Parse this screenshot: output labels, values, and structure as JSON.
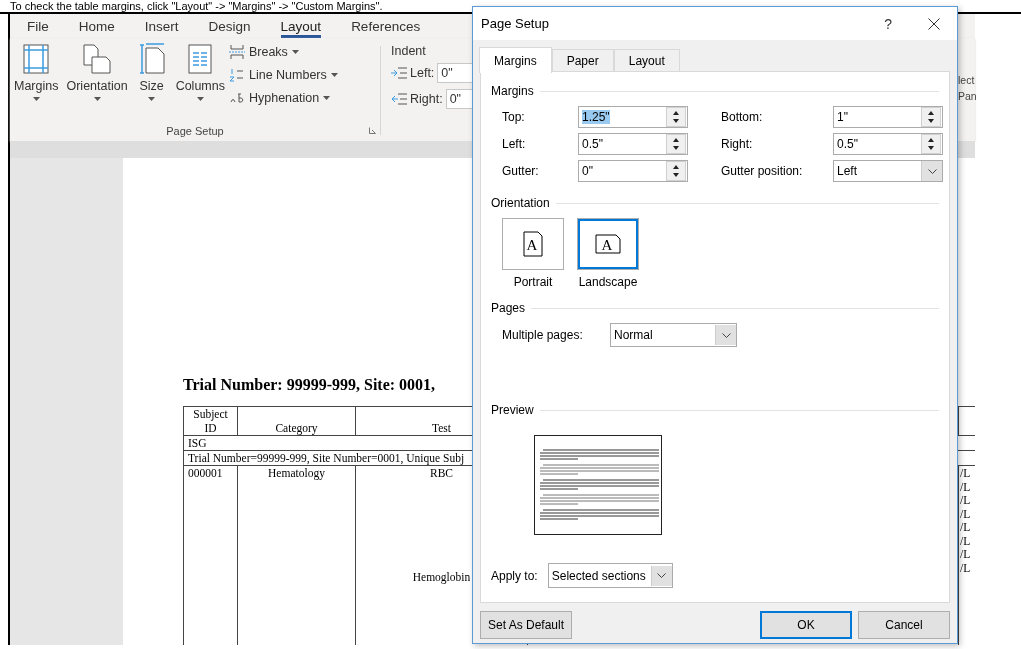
{
  "caption": "To check the table margins, click \"Layout\" -> \"Margins\" -> \"Custom Margins\".",
  "word": {
    "tabs": [
      {
        "label": "File",
        "selected": false
      },
      {
        "label": "Home",
        "selected": false
      },
      {
        "label": "Insert",
        "selected": false
      },
      {
        "label": "Design",
        "selected": false
      },
      {
        "label": "Layout",
        "selected": true
      },
      {
        "label": "References",
        "selected": false
      }
    ],
    "ribbon": {
      "big_buttons": [
        "Margins",
        "Orientation",
        "Size",
        "Columns"
      ],
      "small_buttons": [
        "Breaks",
        "Line Numbers",
        "Hyphenation"
      ],
      "group_label": "Page Setup",
      "indent": {
        "title": "Indent",
        "fields": [
          {
            "label": "Left:",
            "value": "0\""
          },
          {
            "label": "Right:",
            "value": "0\""
          }
        ]
      },
      "right_fragments": [
        "lect",
        "Pan"
      ]
    }
  },
  "document": {
    "title": "Trial Number: 99999-999, Site: 0001,",
    "table": {
      "columns": [
        "Subject ID",
        "Category",
        "Test"
      ],
      "group_row": "ISG",
      "info_row": "Trial Number=99999-999, Site Number=0001, Unique Subj",
      "rows": [
        {
          "subject_id": "000001",
          "category": "Hematology",
          "tests": [
            "RBC",
            "Hemoglobin"
          ]
        }
      ],
      "unit_fragments": [
        "/L",
        "/L",
        "/L",
        "/L",
        "/L",
        "/L",
        "/L",
        "/L"
      ]
    }
  },
  "dialog": {
    "title": "Page Setup",
    "help": "?",
    "tabs": [
      {
        "label": "Margins",
        "selected": true
      },
      {
        "label": "Paper",
        "selected": false
      },
      {
        "label": "Layout",
        "selected": false
      }
    ],
    "margins_heading": "Margins",
    "margin_fields": [
      {
        "kind": "spinner",
        "label": "Top:",
        "value": "1.25\"",
        "selected": true
      },
      {
        "kind": "spinner",
        "label": "Bottom:",
        "value": "1\"",
        "selected": false
      },
      {
        "kind": "spinner",
        "label": "Left:",
        "value": "0.5\"",
        "selected": false
      },
      {
        "kind": "spinner",
        "label": "Right:",
        "value": "0.5\"",
        "selected": false
      },
      {
        "kind": "spinner",
        "label": "Gutter:",
        "value": "0\"",
        "selected": false
      },
      {
        "kind": "dropdown",
        "label": "Gutter position:",
        "value": "Left",
        "selected": false
      }
    ],
    "orientation_heading": "Orientation",
    "orientations": [
      {
        "label": "Portrait",
        "glyph": "A",
        "selected": false
      },
      {
        "label": "Landscape",
        "glyph": "A",
        "selected": true
      }
    ],
    "pages_heading": "Pages",
    "multiple_pages": {
      "label": "Multiple pages:",
      "value": "Normal"
    },
    "preview_heading": "Preview",
    "apply_to": {
      "label": "Apply to:",
      "value": "Selected sections"
    },
    "buttons": [
      {
        "label": "Set As Default",
        "default": false
      },
      {
        "label": "OK",
        "default": true
      },
      {
        "label": "Cancel",
        "default": false
      }
    ]
  }
}
